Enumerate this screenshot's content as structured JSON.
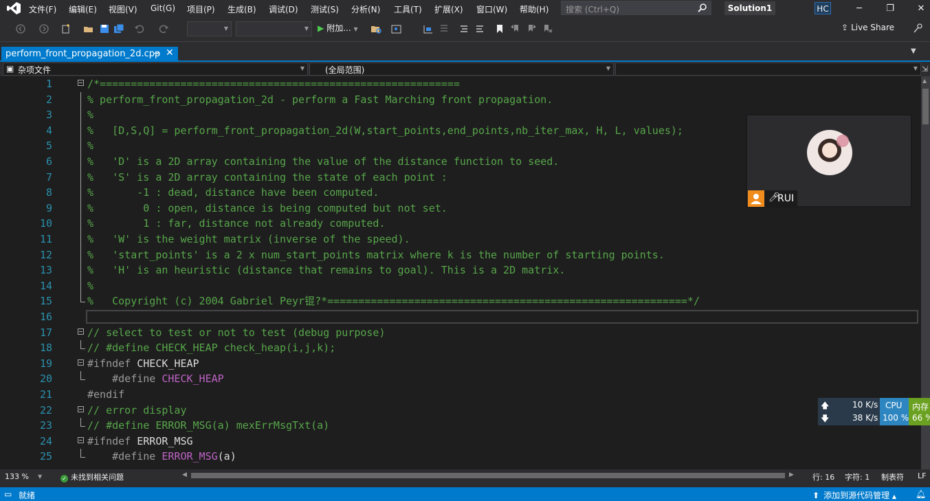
{
  "menu": {
    "items": [
      "文件(F)",
      "编辑(E)",
      "视图(V)",
      "Git(G)",
      "项目(P)",
      "生成(B)",
      "调试(D)",
      "测试(S)",
      "分析(N)",
      "工具(T)",
      "扩展(X)",
      "窗口(W)",
      "帮助(H)"
    ],
    "search_placeholder": "搜索 (Ctrl+Q)",
    "solution": "Solution1",
    "user_initials": "HC"
  },
  "toolbar": {
    "attach_label": "附加...",
    "live_share": "Live Share"
  },
  "tab": {
    "filename": "perform_front_propagation_2d.cpp",
    "pin": "⊸",
    "close": "✕"
  },
  "navbar": {
    "project": "杂项文件",
    "scope": "(全局范围)",
    "member": ""
  },
  "code_lines": [
    {
      "n": "1",
      "parts": [
        {
          "t": "/*==========================================================",
          "c": "c-comment"
        }
      ]
    },
    {
      "n": "2",
      "parts": [
        {
          "t": "% perform_front_propagation_2d - perform a Fast Marching front propagation.",
          "c": "c-comment"
        }
      ]
    },
    {
      "n": "3",
      "parts": [
        {
          "t": "%",
          "c": "c-comment"
        }
      ]
    },
    {
      "n": "4",
      "parts": [
        {
          "t": "%   [D,S,Q] = perform_front_propagation_2d(W,start_points,end_points,nb_iter_max, H, L, values);",
          "c": "c-comment"
        }
      ]
    },
    {
      "n": "5",
      "parts": [
        {
          "t": "%",
          "c": "c-comment"
        }
      ]
    },
    {
      "n": "6",
      "parts": [
        {
          "t": "%   'D' is a 2D array containing the value of the distance function to seed.",
          "c": "c-comment"
        }
      ]
    },
    {
      "n": "7",
      "parts": [
        {
          "t": "%   'S' is a 2D array containing the state of each point :",
          "c": "c-comment"
        }
      ]
    },
    {
      "n": "8",
      "parts": [
        {
          "t": "%       -1 : dead, distance have been computed.",
          "c": "c-comment"
        }
      ]
    },
    {
      "n": "9",
      "parts": [
        {
          "t": "%        0 : open, distance is being computed but not set.",
          "c": "c-comment"
        }
      ]
    },
    {
      "n": "10",
      "parts": [
        {
          "t": "%        1 : far, distance not already computed.",
          "c": "c-comment"
        }
      ]
    },
    {
      "n": "11",
      "parts": [
        {
          "t": "%   'W' is the weight matrix (inverse of the speed).",
          "c": "c-comment"
        }
      ]
    },
    {
      "n": "12",
      "parts": [
        {
          "t": "%   'start_points' is a 2 x num_start_points matrix where k is the number of starting points.",
          "c": "c-comment"
        }
      ]
    },
    {
      "n": "13",
      "parts": [
        {
          "t": "%   'H' is an heuristic (distance that remains to goal). This is a 2D matrix.",
          "c": "c-comment"
        }
      ]
    },
    {
      "n": "14",
      "parts": [
        {
          "t": "%",
          "c": "c-comment"
        }
      ]
    },
    {
      "n": "15",
      "parts": [
        {
          "t": "%   Copyright (c) 2004 Gabriel Peyr锟?*==========================================================*/",
          "c": "c-comment"
        }
      ]
    },
    {
      "n": "16",
      "parts": [
        {
          "t": "",
          "c": "c-white"
        }
      ]
    },
    {
      "n": "17",
      "parts": [
        {
          "t": "// select to test or not to test (debug purpose)",
          "c": "c-comment"
        }
      ]
    },
    {
      "n": "18",
      "parts": [
        {
          "t": "// #define CHECK_HEAP check_heap(i,j,k);",
          "c": "c-comment"
        }
      ]
    },
    {
      "n": "19",
      "parts": [
        {
          "t": "#ifndef ",
          "c": "c-pre"
        },
        {
          "t": "CHECK_HEAP",
          "c": "c-white"
        }
      ]
    },
    {
      "n": "20",
      "parts": [
        {
          "t": "    #define ",
          "c": "c-pre"
        },
        {
          "t": "CHECK_HEAP",
          "c": "c-macro"
        }
      ]
    },
    {
      "n": "21",
      "parts": [
        {
          "t": "#endif",
          "c": "c-pre"
        }
      ]
    },
    {
      "n": "22",
      "parts": [
        {
          "t": "// error display",
          "c": "c-comment"
        }
      ]
    },
    {
      "n": "23",
      "parts": [
        {
          "t": "// #define ERROR_MSG(a) mexErrMsgTxt(a)",
          "c": "c-comment"
        }
      ]
    },
    {
      "n": "24",
      "parts": [
        {
          "t": "#ifndef ",
          "c": "c-pre"
        },
        {
          "t": "ERROR_MSG",
          "c": "c-white"
        }
      ]
    },
    {
      "n": "25",
      "parts": [
        {
          "t": "    #define ",
          "c": "c-pre"
        },
        {
          "t": "ERROR_MSG",
          "c": "c-macro"
        },
        {
          "t": "(a)",
          "c": "c-white"
        }
      ]
    }
  ],
  "editor_status": {
    "zoom": "133 %",
    "issues": "未找到相关问题",
    "line": "行: 16",
    "char": "字符: 1",
    "tabs": "制表符",
    "eol": "LF"
  },
  "statusbar": {
    "ready": "就绪",
    "source_control": "添加到源代码管理"
  },
  "webcam": {
    "name": "RUI"
  },
  "netmon": {
    "up": "10 K/s",
    "down": "38 K/s",
    "cpu_label": "CPU",
    "cpu_value": "100 %",
    "mem_label": "内存",
    "mem_value": "66 %"
  }
}
